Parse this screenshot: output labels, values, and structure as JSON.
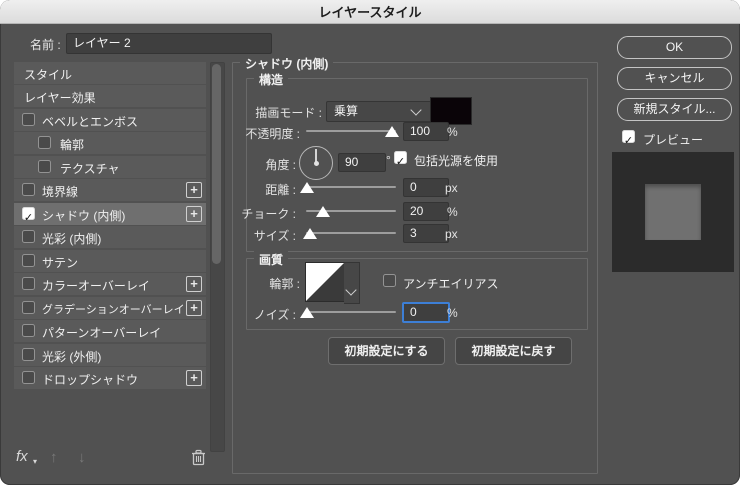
{
  "window": {
    "title": "レイヤースタイル"
  },
  "name_row": {
    "label": "名前 :",
    "value": "レイヤー 2"
  },
  "glyphs": {
    "check": "✓",
    "plus": "+",
    "caret_down": "▾",
    "up_arrow": "↑",
    "down_arrow": "↓",
    "fx": "fx"
  },
  "sidebar": {
    "items": [
      {
        "label": "スタイル",
        "type": "plain",
        "checked": null,
        "selected": false
      },
      {
        "label": "レイヤー効果",
        "type": "plain",
        "checked": null,
        "selected": false
      },
      {
        "label": "ベベルとエンボス",
        "type": "checkbox",
        "checked": false,
        "selected": false
      },
      {
        "label": "輪郭",
        "type": "checkbox",
        "checked": false,
        "indent": true,
        "selected": false
      },
      {
        "label": "テクスチャ",
        "type": "checkbox",
        "checked": false,
        "indent": true,
        "selected": false
      },
      {
        "label": "境界線",
        "type": "checkbox",
        "checked": false,
        "plus": true,
        "selected": false
      },
      {
        "label": "シャドウ (内側)",
        "type": "checkbox",
        "checked": true,
        "plus": true,
        "selected": true
      },
      {
        "label": "光彩 (内側)",
        "type": "checkbox",
        "checked": false,
        "selected": false
      },
      {
        "label": "サテン",
        "type": "checkbox",
        "checked": false,
        "selected": false
      },
      {
        "label": "カラーオーバーレイ",
        "type": "checkbox",
        "checked": false,
        "plus": true,
        "selected": false
      },
      {
        "label": "グラデーションオーバーレイ",
        "type": "checkbox",
        "checked": false,
        "plus": true,
        "selected": false
      },
      {
        "label": "パターンオーバーレイ",
        "type": "checkbox",
        "checked": false,
        "selected": false
      },
      {
        "label": "光彩 (外側)",
        "type": "checkbox",
        "checked": false,
        "selected": false
      },
      {
        "label": "ドロップシャドウ",
        "type": "checkbox",
        "checked": false,
        "plus": true,
        "selected": false
      }
    ]
  },
  "panel": {
    "title": "シャドウ (内側)",
    "structure": {
      "title": "構造",
      "blend_mode": {
        "label": "描画モード :",
        "value": "乗算",
        "swatch_color": "#0a0408"
      },
      "opacity": {
        "label": "不透明度 :",
        "value": "100",
        "unit": "%",
        "percent": 100
      },
      "angle": {
        "label": "角度 :",
        "value": "90",
        "unit": "°",
        "global_light_label": "包括光源を使用",
        "global_light_checked": true
      },
      "distance": {
        "label": "距離 :",
        "value": "0",
        "unit": "px",
        "percent": 0
      },
      "choke": {
        "label": "チョーク :",
        "value": "20",
        "unit": "%",
        "percent": 20
      },
      "size": {
        "label": "サイズ :",
        "value": "3",
        "unit": "px",
        "percent": 4
      }
    },
    "quality": {
      "title": "画質",
      "contour": {
        "label": "輪郭 :",
        "antialias_label": "アンチエイリアス",
        "antialias_checked": false
      },
      "noise": {
        "label": "ノイズ :",
        "value": "0",
        "unit": "%",
        "percent": 0,
        "focused": true
      }
    },
    "defaults": {
      "make_default": "初期設定にする",
      "reset_default": "初期設定に戻す"
    }
  },
  "actions": {
    "ok": "OK",
    "cancel": "キャンセル",
    "new_style": "新規スタイル...",
    "preview_label": "プレビュー",
    "preview_checked": true
  },
  "colors": {
    "focus_ring": "#3d7fd6",
    "shadow_swatch": "#0a0408",
    "dialog_bg": "#515151",
    "titlebar_bg": "#e8e8e8"
  }
}
